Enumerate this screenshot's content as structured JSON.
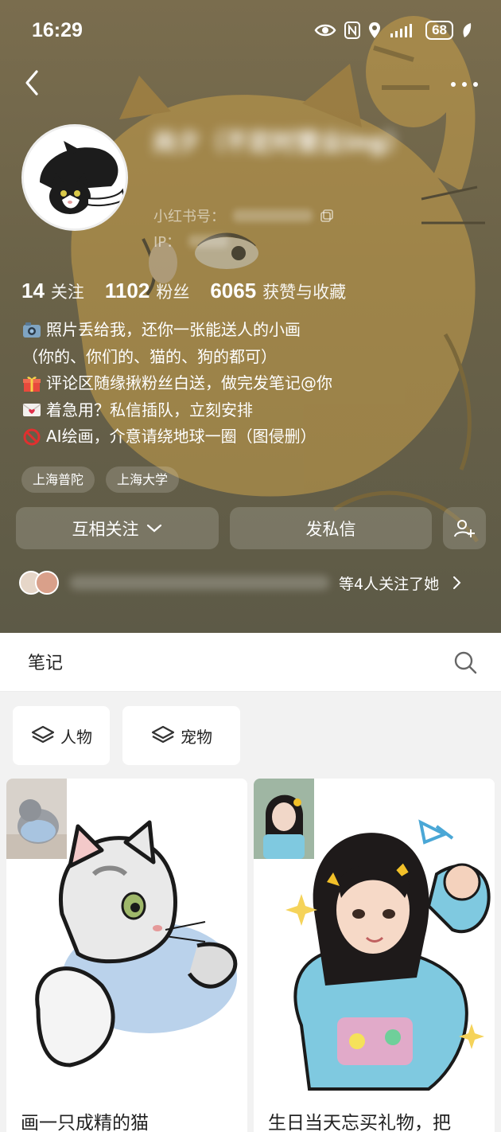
{
  "status_bar": {
    "time": "16:29",
    "battery": "68"
  },
  "profile": {
    "name": "尚夕（不定时营业ing）",
    "id_label": "小红书号：",
    "ip_label": "IP：",
    "stats": [
      {
        "value": "14",
        "label": "关注"
      },
      {
        "value": "1102",
        "label": "粉丝"
      },
      {
        "value": "6065",
        "label": "获赞与收藏"
      }
    ],
    "bio": [
      {
        "icon": "camera-icon",
        "text": "照片丢给我，还你一张能送人的小画"
      },
      {
        "icon": "",
        "text": "（你的、你们的、猫的、狗的都可）"
      },
      {
        "icon": "gift-icon",
        "text": "评论区随缘揪粉丝白送，做完发笔记@你"
      },
      {
        "icon": "love-letter-icon",
        "text": "着急用？私信插队，立刻安排"
      },
      {
        "icon": "prohibited-icon",
        "text": "AI绘画，介意请绕地球一圈（图侵删）"
      }
    ],
    "tags": [
      "上海普陀",
      "上海大学"
    ],
    "actions": {
      "follow_label": "互相关注",
      "message_label": "发私信"
    },
    "mutual_text": "等4人关注了她"
  },
  "notes": {
    "title": "笔记",
    "filters": [
      "人物",
      "宠物"
    ],
    "cards": [
      {
        "title": "画一只成精的猫"
      },
      {
        "title": "生日当天忘买礼物，把"
      }
    ]
  }
}
